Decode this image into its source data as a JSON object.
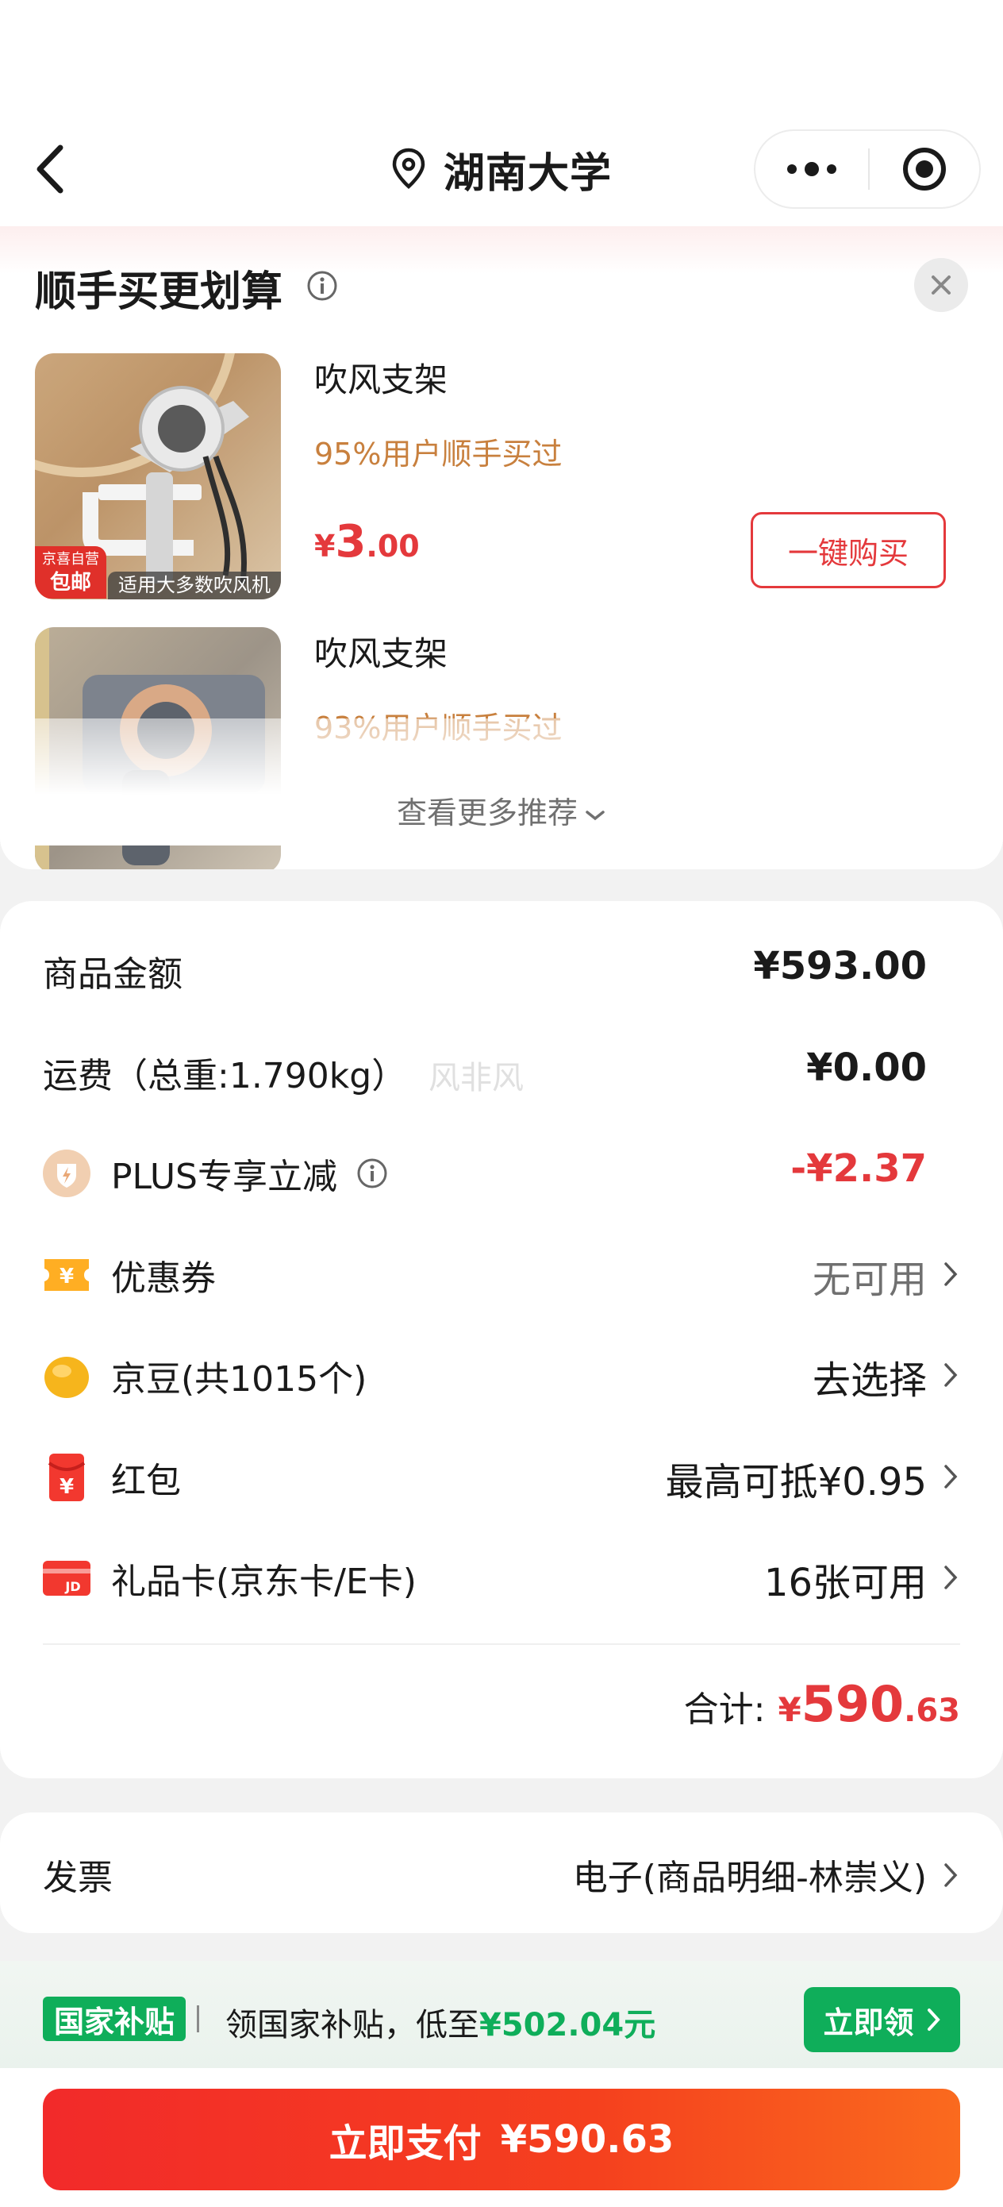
{
  "header": {
    "location": "湖南大学"
  },
  "upsell": {
    "title": "顺手买更划算",
    "products": [
      {
        "name": "吹风支架",
        "buyers": "95%用户顺手买过",
        "price_yen": "¥",
        "price_int": "3",
        "price_dec": ".00",
        "badge_brand": "京喜自营",
        "badge_ship": "包邮",
        "caption": "适用大多数吹风机",
        "button": "一键购买"
      },
      {
        "name": "吹风支架",
        "buyers": "93%用户顺手买过"
      }
    ],
    "more": "查看更多推荐"
  },
  "price": {
    "goods": {
      "label": "商品金额",
      "value": "¥593.00"
    },
    "shipping": {
      "label": "运费（总重:1.790kg）",
      "value": "¥0.00",
      "ghost": "风非风"
    },
    "plus": {
      "label": "PLUS专享立减",
      "value": "-¥2.37"
    },
    "coupon": {
      "label": "优惠券",
      "value": "无可用"
    },
    "beans": {
      "label": "京豆(共1015个)",
      "value": "去选择"
    },
    "redpacket": {
      "label": "红包",
      "value": "最高可抵¥0.95"
    },
    "giftcard": {
      "label": "礼品卡(京东卡/E卡)",
      "value": "16张可用"
    },
    "total": {
      "label": "合计:",
      "yen": "¥",
      "int": "590",
      "dec": ".63"
    }
  },
  "invoice": {
    "label": "发票",
    "value": "电子(商品明细-林崇义)"
  },
  "subsidy": {
    "badge": "国家补贴",
    "text": "领国家补贴，低至",
    "amount": "¥502.04元",
    "button": "立即领"
  },
  "pay": {
    "label": "立即支付",
    "amount": "¥590.63"
  },
  "colors": {
    "accent_red": "#e4393c",
    "subsidy_green": "#0fae5a",
    "buyers_orange": "#c8803e"
  }
}
